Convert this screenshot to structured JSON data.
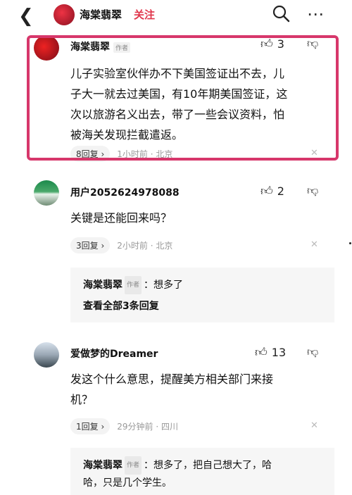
{
  "header": {
    "back_icon": "chevron-left-icon",
    "account_name": "海棠翡翠",
    "follow_label": "关注",
    "search_icon": "search-icon",
    "more_icon": "more-dots-icon"
  },
  "comments": [
    {
      "user": "海棠翡翠",
      "tag": "作者",
      "likes": "3",
      "text_lines": [
        "儿子实验室伙伴办不下美国签证出不去，儿",
        "子大一就去过美国，有10年期美国签证，这",
        "次以旅游名义出去，带了一些会议资料，怕",
        "被海关发现拦截遣返。"
      ],
      "reply_label": "8回复 ›",
      "meta": "1小时前 · 北京",
      "highlight_color": "#d7376b"
    },
    {
      "user": "用户2052624978088",
      "likes": "2",
      "text_lines": [
        "关键是还能回来吗？"
      ],
      "reply_label": "3回复 ›",
      "meta": "2小时前 · 北京",
      "sub_reply": {
        "user": "海棠翡翠",
        "tag": "作者",
        "text": "：想多了",
        "view_all": "查看全部3条回复"
      }
    },
    {
      "user": "爱做梦的Dreamer",
      "likes": "13",
      "text_lines": [
        "发这个什么意思，提醒美方相关部门来接",
        "机？"
      ],
      "reply_label": "1回复 ›",
      "meta": "29分钟前 · 四川",
      "sub_reply": {
        "user": "海棠翡翠",
        "tag": "作者",
        "text_line1": "：想多了，把自己想大了，哈",
        "text_line2": "哈，只是几个学生。"
      }
    }
  ],
  "icons": {
    "like": "thumbs-up-icon",
    "dislike": "thumbs-down-icon",
    "close": "close-icon"
  },
  "colors": {
    "accent": "#e0364b",
    "highlight": "#d7376b"
  }
}
